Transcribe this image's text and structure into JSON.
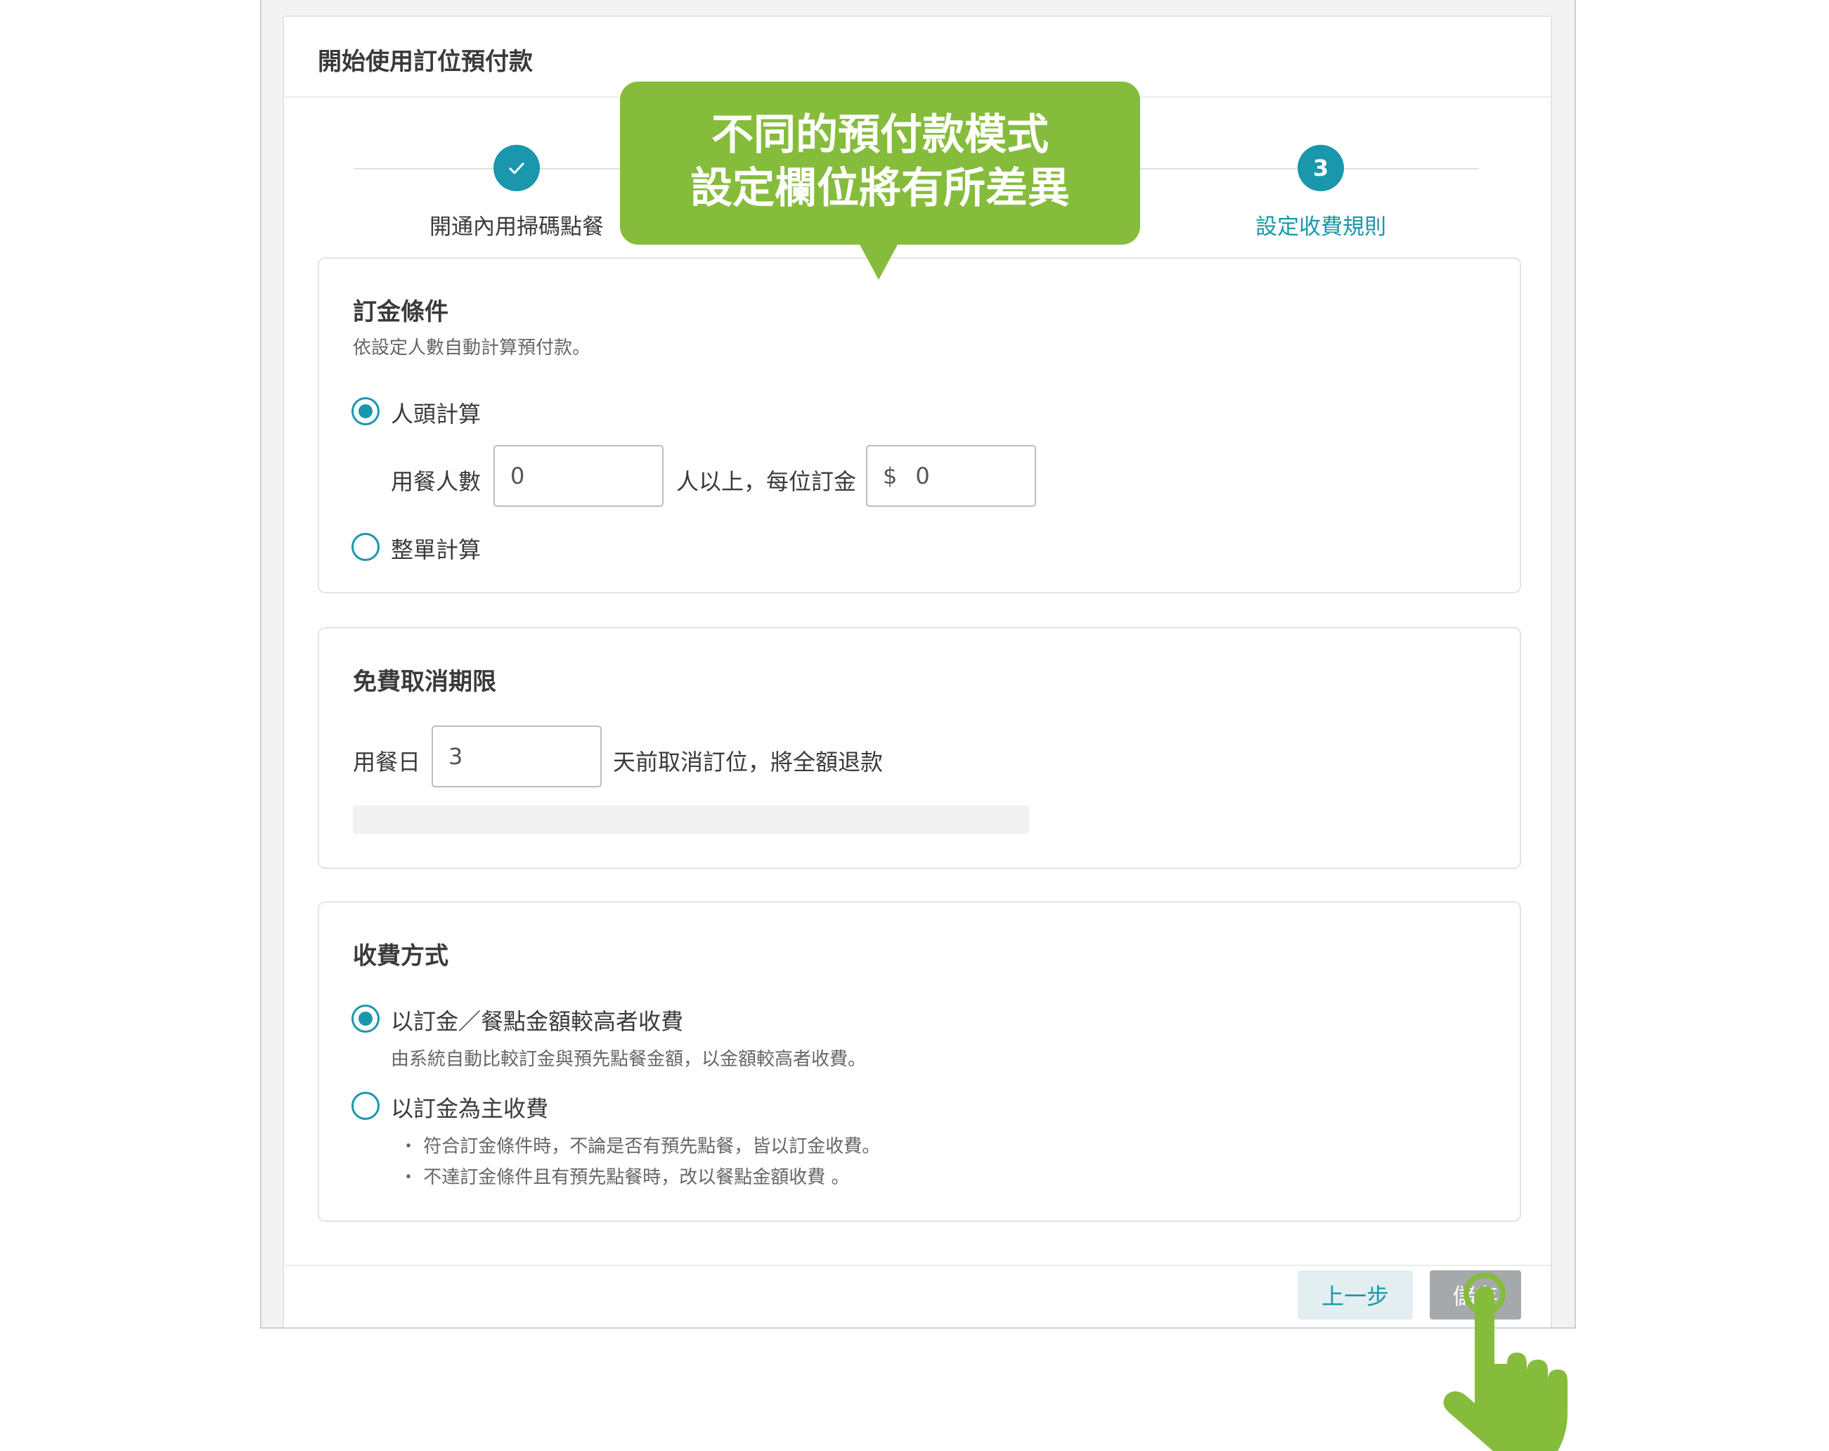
{
  "dialog": {
    "title": "開始使用訂位預付款"
  },
  "stepper": {
    "steps": [
      {
        "label": "開通內用掃碼點餐",
        "state": "done",
        "icon": "check-icon"
      },
      {
        "label": "設定收費規則",
        "state": "active",
        "number": "3"
      }
    ]
  },
  "callout": {
    "line1": "不同的預付款模式",
    "line2": "設定欄位將有所差異"
  },
  "deposit": {
    "title": "訂金條件",
    "desc": "依設定人數自動計算預付款。",
    "per_person": {
      "label": "人頭計算",
      "checked": true,
      "guests_label": "用餐人數",
      "guests_value": "0",
      "mid_text": "人以上，每位訂金",
      "amount_prefix": "$",
      "amount_value": "0"
    },
    "whole_order": {
      "label": "整單計算",
      "checked": false
    }
  },
  "cancel": {
    "title": "免費取消期限",
    "prefix": "用餐日",
    "days_value": "3",
    "suffix": "天前取消訂位，將全額退款"
  },
  "charge": {
    "title": "收費方式",
    "option_higher": {
      "label": "以訂金／餐點金額較高者收費",
      "checked": true,
      "note": "由系統自動比較訂金與預先點餐金額，以金額較高者收費。"
    },
    "option_deposit": {
      "label": "以訂金為主收費",
      "checked": false,
      "notes": [
        "・ 符合訂金條件時，不論是否有預先點餐，皆以訂金收費。",
        "・ 不達訂金條件且有預先點餐時，改以餐點金額收費 。"
      ]
    }
  },
  "footer": {
    "prev_label": "上一步",
    "save_label": "儲存"
  },
  "colors": {
    "accent": "#1a97ad",
    "callout": "#86bc3c",
    "save_disabled": "#a6a9ab"
  }
}
